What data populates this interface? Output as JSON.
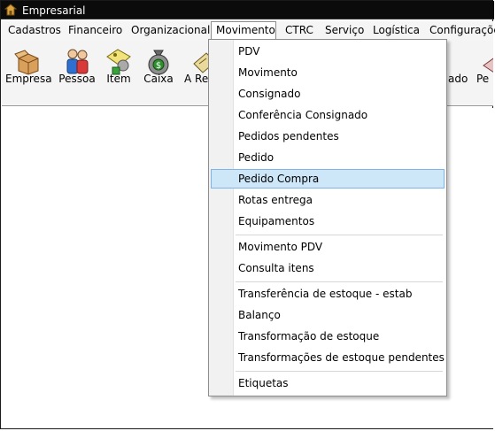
{
  "window": {
    "title": "Empresarial"
  },
  "menubar": {
    "items": [
      "Cadastros",
      "Financeiro",
      "Organizacional",
      "Movimento",
      "CTRC",
      "Serviço",
      "Logística",
      "Configurações"
    ],
    "active": "Movimento"
  },
  "toolbar": {
    "items": [
      {
        "label": "Empresa",
        "icon": "open-box-icon"
      },
      {
        "label": "Pessoa",
        "icon": "people-icon"
      },
      {
        "label": "Item",
        "icon": "item-tag-icon"
      },
      {
        "label": "Caixa",
        "icon": "money-bag-icon"
      },
      {
        "label": "A Rec",
        "icon": "receivable-icon"
      },
      {
        "label": "ado",
        "icon": "partial-icon"
      },
      {
        "label": "Pe",
        "icon": "partial-icon-2"
      }
    ]
  },
  "dropdown": {
    "groups": [
      [
        "PDV",
        "Movimento",
        "Consignado",
        "Conferência Consignado",
        "Pedidos pendentes",
        "Pedido",
        "Pedido Compra",
        "Rotas entrega",
        "Equipamentos"
      ],
      [
        "Movimento PDV",
        "Consulta itens"
      ],
      [
        "Transferência de estoque - estab",
        "Balanço",
        "Transformação de estoque",
        "Transformações de estoque pendentes"
      ],
      [
        "Etiquetas"
      ]
    ],
    "highlighted": "Pedido Compra",
    "colors": {
      "hover_bg": "#cde6f8",
      "hover_border": "#7eb4ea"
    }
  }
}
